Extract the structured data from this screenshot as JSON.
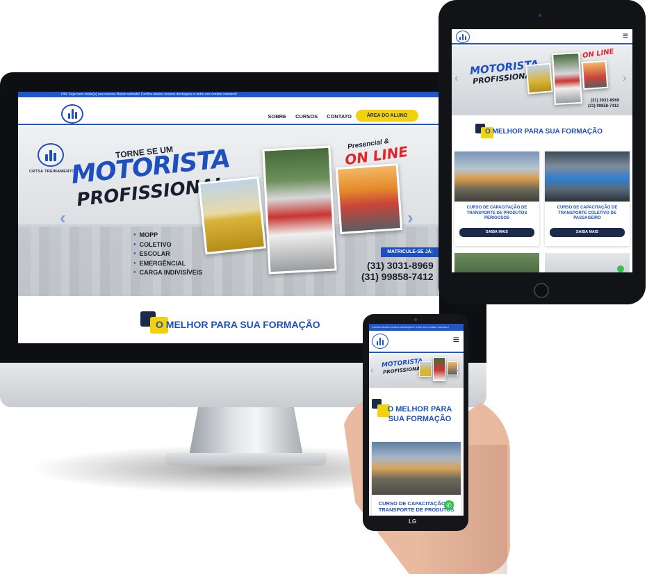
{
  "desktop": {
    "topbar_text": "Olá! Seja bem-vindo(a) aos nossos Nosso website! Confira abaixo nossos destaques e entre em contato conosco!",
    "nav": [
      "SOBRE",
      "CURSOS",
      "CONTATO"
    ],
    "cta": "ÁREA DO ALUNO",
    "hero": {
      "brand": "CRTSA TREINAMENTOS",
      "torne": "TORNE SE UM",
      "motorista": "MOTORISTA",
      "profissional": "PROFISSIONAL",
      "courses": [
        "MOPP",
        "COLETIVO",
        "ESCOLAR",
        "EMERGÊNCIAL",
        "CARGA INDIVISÍVEIS"
      ],
      "presencial": "Presencial &",
      "online": "ON LINE",
      "matricule": "MATRICULE-SE JÁ:",
      "phone1": "(31) 3031-8969",
      "phone2": "(31) 99858-7412"
    },
    "section_heading": "O MELHOR PARA SUA FORMAÇÃO"
  },
  "tablet": {
    "section_heading": "O MELHOR PARA SUA FORMAÇÃO",
    "cards": [
      {
        "title": "CURSO DE CAPACITAÇÃO DE TRANSPORTE DE PRODUTOS PERIGOSOS",
        "button": "SAIBA MAIS"
      },
      {
        "title": "CURSO DE CAPACITAÇÃO DE TRANSPORTE COLETIVO DE PASSAGEIRO",
        "button": "SAIBA MAIS"
      }
    ],
    "hero_phone1": "(31) 3031-8969",
    "hero_phone2": "(31) 99858-7412"
  },
  "phone": {
    "topbar_text": "Confira abaixo nossos destaques e entre em contato conosco!",
    "section_heading": "O MELHOR PARA SUA FORMAÇÃO",
    "card_title": "CURSO DE CAPACITAÇÃO DE TRANSPORTE DE PRODUTOS",
    "brand": "LG"
  },
  "colors": {
    "primary": "#1d4fbf",
    "navy": "#1b2a4a",
    "yellow": "#f2d20d",
    "red": "#e0262b",
    "whatsapp": "#2ec24b"
  }
}
